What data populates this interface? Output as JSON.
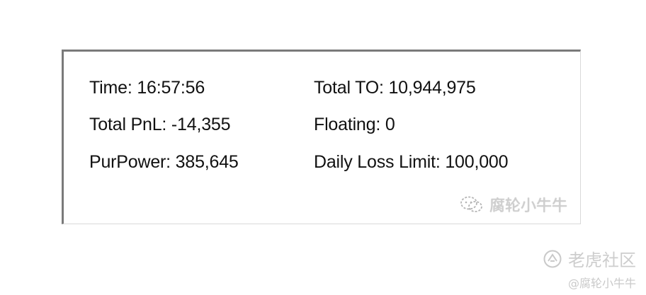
{
  "panel": {
    "time": "Time: 16:57:56",
    "total_pnl": "Total PnL: -14,355",
    "pur_power": "PurPower: 385,645",
    "total_to": "Total TO: 10,944,975",
    "floating": "Floating: 0",
    "daily_loss_limit": "Daily Loss Limit: 100,000"
  },
  "watermark_inner": {
    "text": "腐轮小牛牛",
    "icon": "wechat-logo-icon"
  },
  "watermark_outer": {
    "brand": "老虎社区",
    "handle": "@腐轮小牛牛",
    "icon": "tiger-community-logo-icon"
  }
}
